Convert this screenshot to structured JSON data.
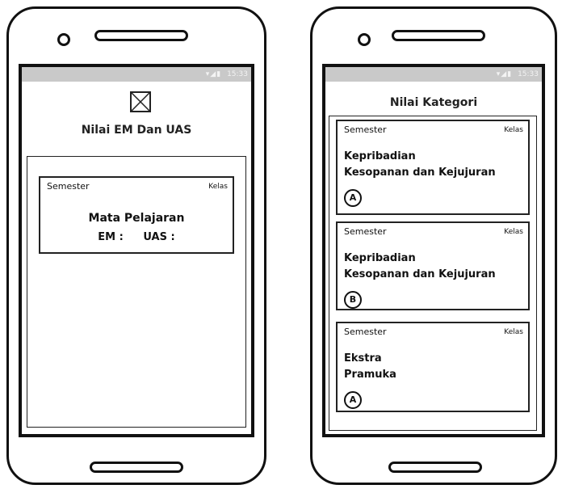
{
  "statusbar": {
    "icons": "▾◢▮",
    "time": "15:33"
  },
  "left_screen": {
    "title": "Nilai EM Dan UAS",
    "card": {
      "semester": "Semester",
      "kelas": "Kelas",
      "subject": "Mata Pelajaran",
      "em_label": "EM :",
      "uas_label": "UAS :"
    }
  },
  "right_screen": {
    "title": "Nilai Kategori",
    "cards": [
      {
        "semester": "Semester",
        "kelas": "Kelas",
        "category": "Kepribadian",
        "item": "Kesopanan dan Kejujuran",
        "grade": "A"
      },
      {
        "semester": "Semester",
        "kelas": "Kelas",
        "category": "Kepribadian",
        "item": "Kesopanan dan Kejujuran",
        "grade": "B"
      },
      {
        "semester": "Semester",
        "kelas": "Kelas",
        "category": "Ekstra",
        "item": "Pramuka",
        "grade": "A"
      }
    ]
  },
  "icons": {
    "image_placeholder": "image-placeholder-icon",
    "wifi": "wifi-icon",
    "signal": "signal-icon",
    "battery": "battery-icon"
  }
}
